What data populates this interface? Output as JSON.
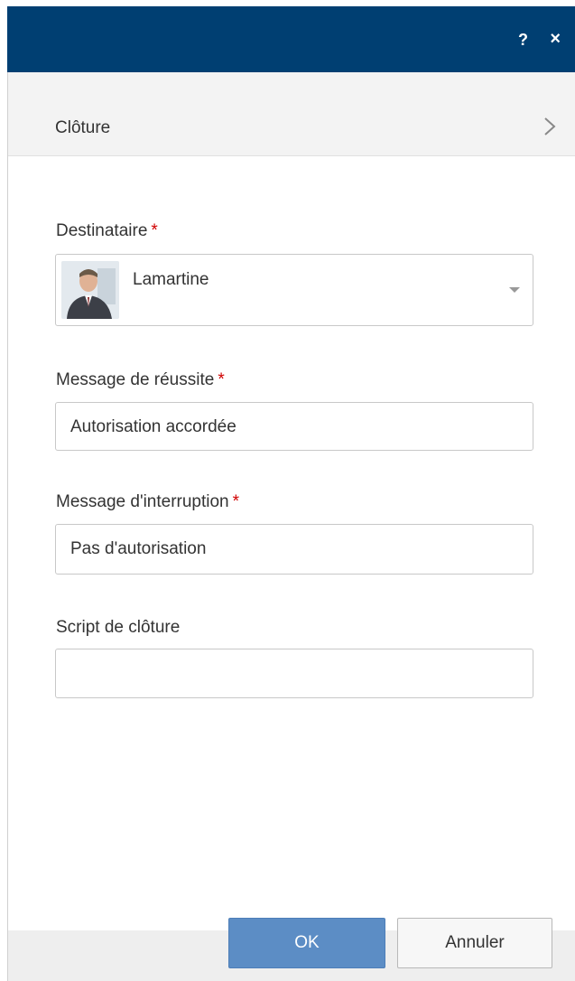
{
  "titlebar": {
    "help_label": "?",
    "close_label": "×"
  },
  "section": {
    "title": "Clôture"
  },
  "fields": {
    "destinataire": {
      "label": "Destinataire",
      "required_mark": "*",
      "value": "Lamartine"
    },
    "success_message": {
      "label": "Message de réussite",
      "required_mark": "*",
      "value": "Autorisation accordée"
    },
    "interrupt_message": {
      "label": "Message d'interruption",
      "required_mark": "*",
      "value": "Pas d'autorisation"
    },
    "closing_script": {
      "label": "Script de clôture",
      "value": ""
    }
  },
  "buttons": {
    "ok": "OK",
    "cancel": "Annuler"
  },
  "colors": {
    "titlebar": "#003f72",
    "required": "#d00000",
    "ok_button": "#5c8dc5"
  }
}
